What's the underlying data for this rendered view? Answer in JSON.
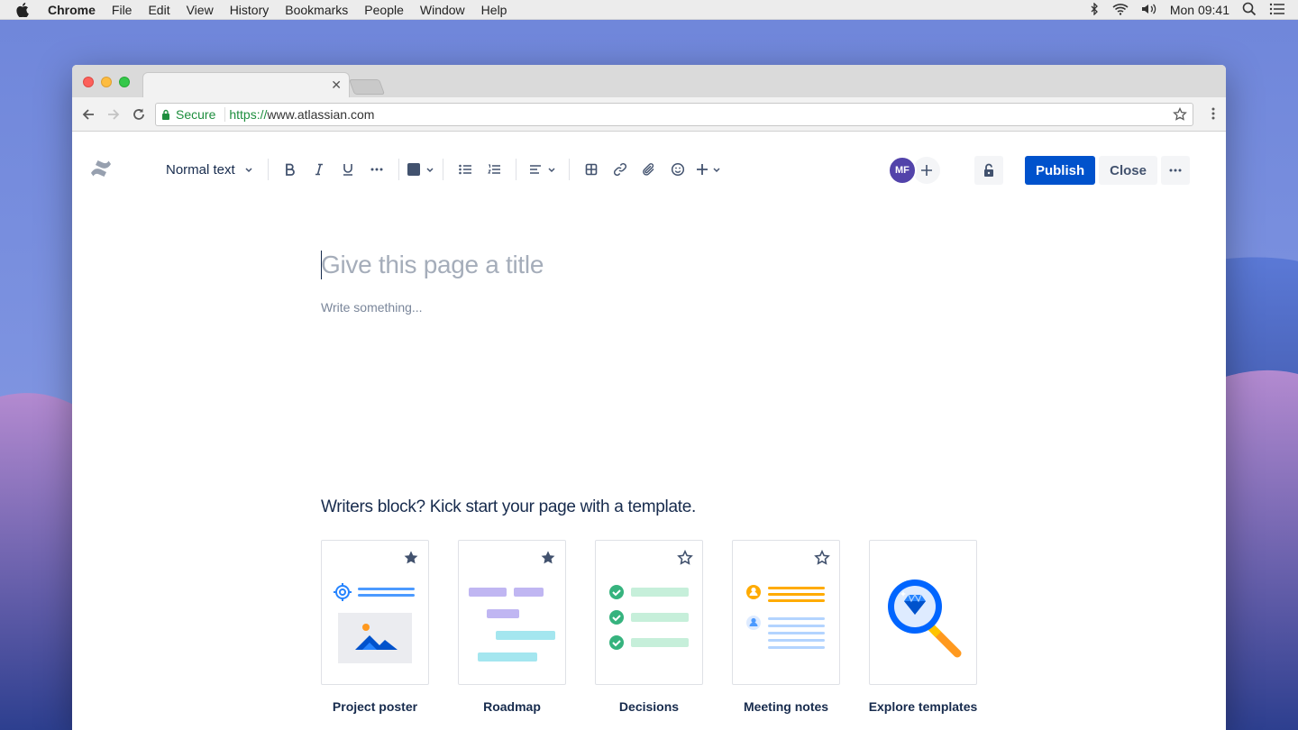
{
  "menubar": {
    "app_name": "Chrome",
    "items": [
      "File",
      "Edit",
      "View",
      "History",
      "Bookmarks",
      "People",
      "Window",
      "Help"
    ],
    "clock": "Mon 09:41"
  },
  "browser": {
    "secure_label": "Secure",
    "url_scheme": "https://",
    "url_host": "www.atlassian.com"
  },
  "editor_toolbar": {
    "text_style": "Normal text",
    "avatar_initials": "MF",
    "publish_label": "Publish",
    "close_label": "Close"
  },
  "document": {
    "title_placeholder": "Give this page a title",
    "body_placeholder": "Write something..."
  },
  "templates": {
    "heading": "Writers block? Kick start your page with a template.",
    "cards": [
      {
        "label": "Project poster",
        "starred": true
      },
      {
        "label": "Roadmap",
        "starred": true
      },
      {
        "label": "Decisions",
        "starred": false
      },
      {
        "label": "Meeting notes",
        "starred": false
      },
      {
        "label": "Explore templates"
      }
    ]
  },
  "colors": {
    "primary": "#0052cc",
    "avatar": "#5243aa",
    "text": "#172b4d",
    "secure_green": "#1e8e3e"
  }
}
